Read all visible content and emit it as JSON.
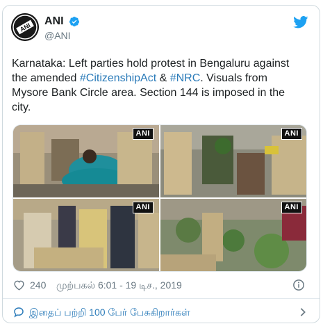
{
  "tweet": {
    "display_name": "ANI",
    "handle": "@ANI",
    "text_parts": [
      "Karnataka: Left parties hold protest in Bengaluru against the amended ",
      "#CitizenshipAct",
      " & ",
      "#NRC",
      ". Visuals from Mysore Bank Circle area. Section 144 is imposed in the city."
    ],
    "avatar_text": "ANI",
    "media_badges": [
      "ANI",
      "ANI",
      "ANI",
      "ANI"
    ],
    "likes": "240",
    "timestamp": "முற்பகல் 6:01 - 19 டிச., 2019",
    "footer_text": "இதைப் பற்றி 100 பேர் பேசுகிறார்கள்"
  },
  "colors": {
    "link": "#2b7bb9",
    "verified": "#1da1f2",
    "secondary_text": "#697882",
    "border": "#cfd9de"
  },
  "icons": [
    "verified-badge-icon",
    "twitter-bird-icon",
    "heart-icon",
    "info-icon",
    "speech-bubble-icon",
    "chevron-right-icon"
  ]
}
